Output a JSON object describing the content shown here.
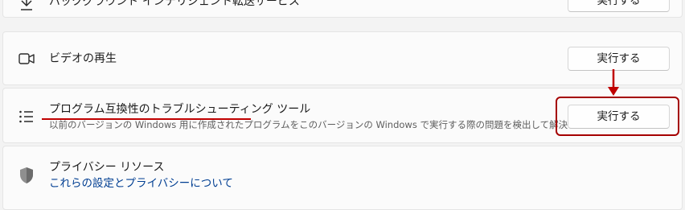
{
  "rows": [
    {
      "id": "background-transfer",
      "title": "バックグラウンド インテリジェント転送サービス",
      "button": "実行する",
      "icon": "download-icon"
    },
    {
      "id": "video-playback",
      "title": "ビデオの再生",
      "button": "実行する",
      "icon": "video-camera-icon"
    },
    {
      "id": "program-compat",
      "title": "プログラム互換性のトラブルシューティング ツール",
      "description": "以前のバージョンの Windows 用に作成されたプログラムをこのバージョンの Windows で実行する際の問題を検出して解決します。",
      "button": "実行する",
      "icon": "list-icon"
    },
    {
      "id": "privacy",
      "title": "プライバシー リソース",
      "link": "これらの設定とプライバシーについて",
      "icon": "shield-icon"
    }
  ],
  "colors": {
    "annotation_red": "#c00000",
    "link_blue": "#003e92",
    "page_bg": "#f3f3f3",
    "card_bg": "#fbfbfb"
  }
}
